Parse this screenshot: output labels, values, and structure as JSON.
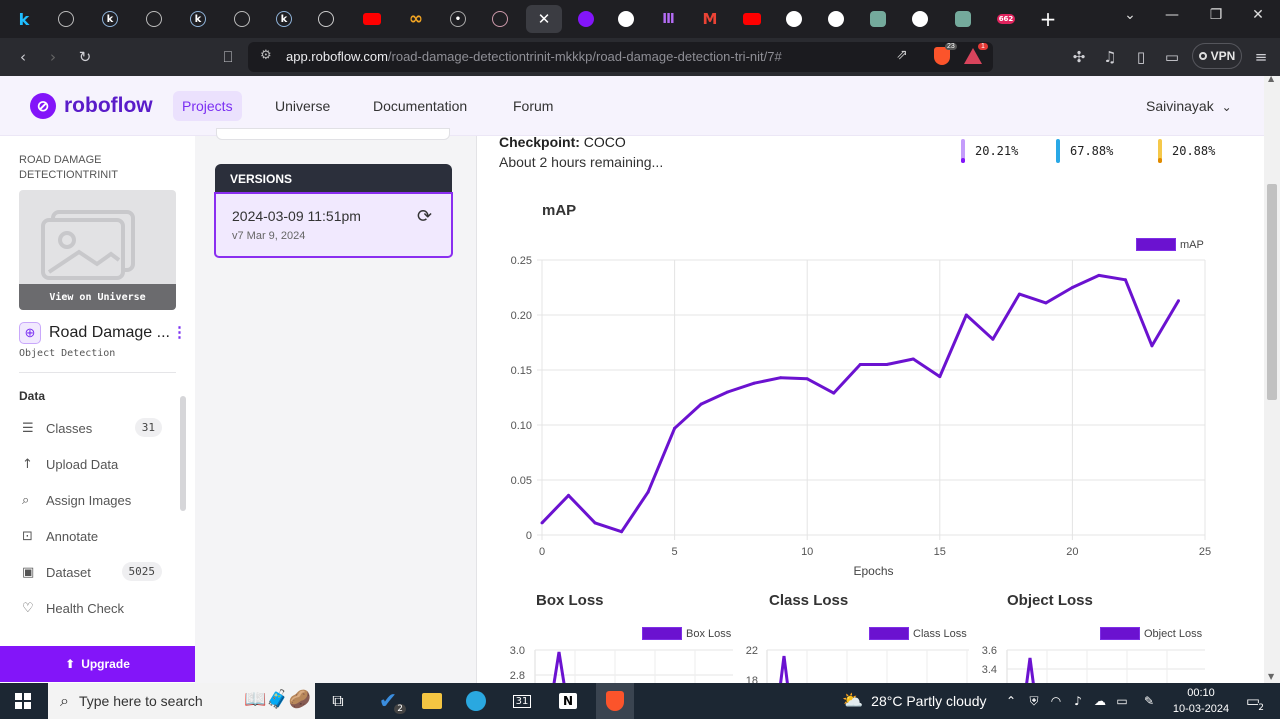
{
  "browser": {
    "url_host": "app.roboflow.com",
    "url_path": "/road-damage-detectiontrinit-mkkkp/road-damage-detection-tri-nit/7#",
    "vpn_label": "VPN",
    "brave_badge": "23",
    "alert_badge": "1",
    "tab_badge": "662"
  },
  "nav": {
    "brand": "roboflow",
    "links": [
      "Projects",
      "Universe",
      "Documentation",
      "Forum"
    ],
    "user": "Saivinayak"
  },
  "sidebar": {
    "project_heading": "ROAD DAMAGE DETECTIONTRINIT",
    "view_universe": "View on Universe",
    "project_title": "Road Damage ...",
    "project_type": "Object Detection",
    "section": "Data",
    "items": [
      {
        "label": "Classes",
        "icon": "list-icon",
        "badge": "31"
      },
      {
        "label": "Upload Data",
        "icon": "upload-icon",
        "badge": ""
      },
      {
        "label": "Assign Images",
        "icon": "search-icon",
        "badge": ""
      },
      {
        "label": "Annotate",
        "icon": "annotate-icon",
        "badge": ""
      },
      {
        "label": "Dataset",
        "icon": "images-icon",
        "badge": "5025"
      },
      {
        "label": "Health Check",
        "icon": "heart-icon",
        "badge": ""
      }
    ],
    "upgrade": "Upgrade"
  },
  "versions": {
    "heading": "VERSIONS",
    "items": [
      {
        "date": "2024-03-09 11:51pm",
        "sub": "v7 Mar 9, 2024"
      }
    ]
  },
  "training": {
    "checkpoint_label": "Checkpoint:",
    "checkpoint_value": "COCO",
    "remaining": "About 2 hours remaining...",
    "metrics": [
      {
        "value": "20.21%",
        "color": "#c49cfb"
      },
      {
        "value": "67.88%",
        "color": "#29a8e6"
      },
      {
        "value": "20.88%",
        "color": "#f5c84a"
      }
    ]
  },
  "chart_data": [
    {
      "type": "line",
      "title": "mAP",
      "xlabel": "Epochs",
      "ylabel": "",
      "xlim": [
        0,
        25
      ],
      "ylim": [
        0,
        0.25
      ],
      "xticks": [
        0,
        5,
        10,
        15,
        20,
        25
      ],
      "yticks": [
        "0",
        "0.05",
        "0.10",
        "0.15",
        "0.20",
        "0.25"
      ],
      "grid": true,
      "legend": "top-right",
      "series": [
        {
          "name": "mAP",
          "color": "#6b12d0",
          "x": [
            0,
            1,
            2,
            3,
            4,
            5,
            6,
            7,
            8,
            9,
            10,
            11,
            12,
            13,
            14,
            15,
            16,
            17,
            18,
            19,
            20,
            21,
            22,
            23,
            24
          ],
          "y": [
            0.011,
            0.036,
            0.011,
            0.003,
            0.039,
            0.097,
            0.119,
            0.13,
            0.138,
            0.143,
            0.142,
            0.129,
            0.155,
            0.155,
            0.16,
            0.144,
            0.2,
            0.178,
            0.219,
            0.211,
            0.225,
            0.236,
            0.232,
            0.172,
            0.213
          ]
        }
      ]
    },
    {
      "type": "line",
      "title": "Box Loss",
      "yticks": [
        "3.0",
        "2.8"
      ],
      "legend": "top-right",
      "series": [
        {
          "name": "Box Loss",
          "color": "#6b12d0"
        }
      ]
    },
    {
      "type": "line",
      "title": "Class Loss",
      "yticks": [
        "22",
        "18"
      ],
      "legend": "top-right",
      "series": [
        {
          "name": "Class Loss",
          "color": "#6b12d0"
        }
      ]
    },
    {
      "type": "line",
      "title": "Object Loss",
      "yticks": [
        "3.6",
        "3.4"
      ],
      "legend": "top-right",
      "series": [
        {
          "name": "Object Loss",
          "color": "#6b12d0"
        }
      ]
    }
  ],
  "taskbar": {
    "search_placeholder": "Type here to search",
    "weather": "28°C  Partly cloudy",
    "time": "00:10",
    "date": "10-03-2024",
    "notifications": "2",
    "todo_badge": "2"
  }
}
